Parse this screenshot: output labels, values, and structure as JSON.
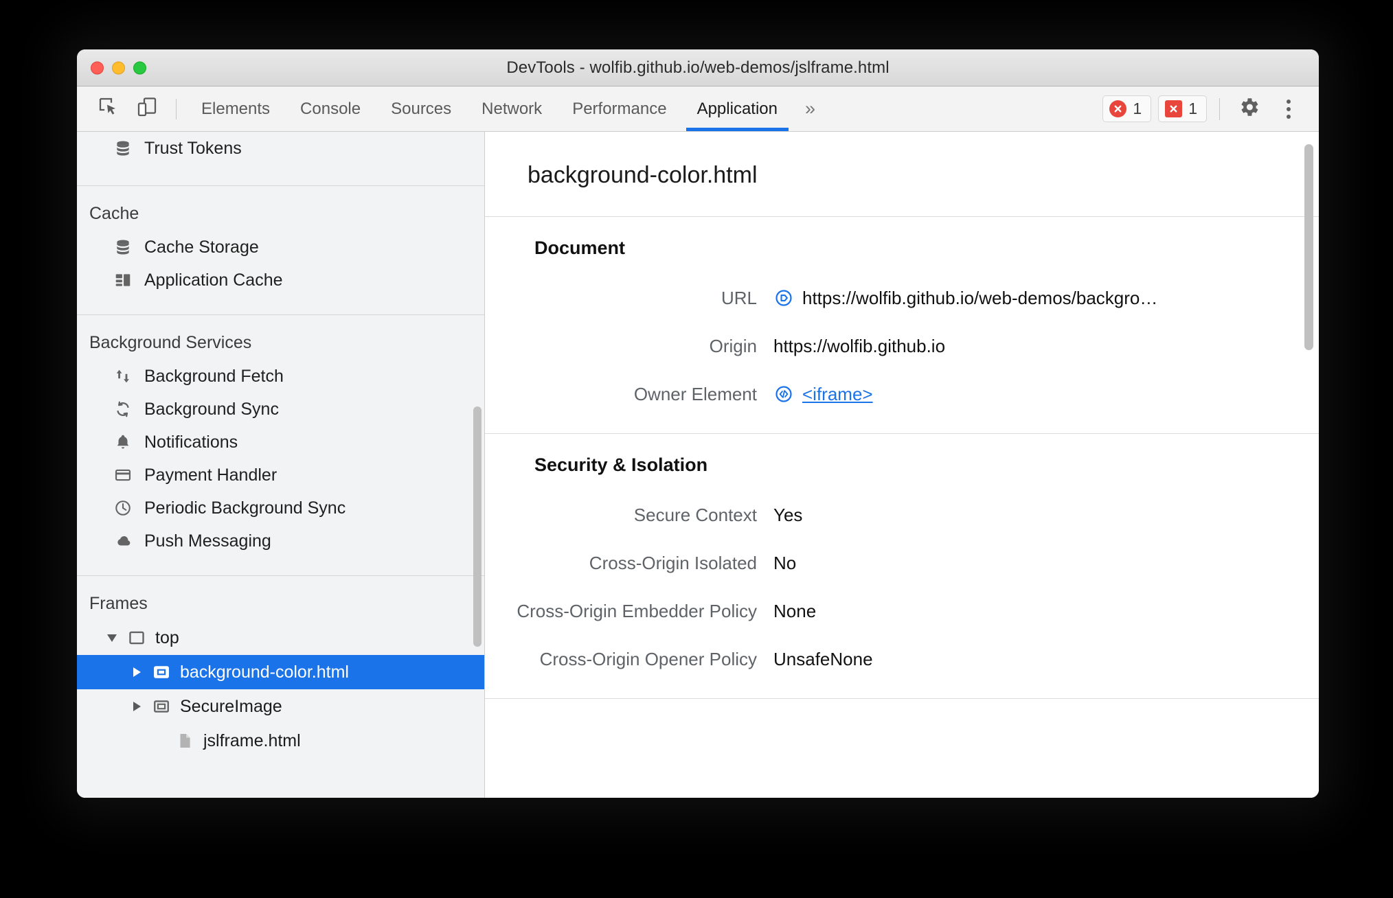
{
  "window": {
    "title": "DevTools - wolfib.github.io/web-demos/jslframe.html"
  },
  "toolbar": {
    "inspect_icon": "inspect-element-icon",
    "device_icon": "device-toolbar-icon",
    "tabs": [
      {
        "label": "Elements",
        "active": false
      },
      {
        "label": "Console",
        "active": false
      },
      {
        "label": "Sources",
        "active": false
      },
      {
        "label": "Network",
        "active": false
      },
      {
        "label": "Performance",
        "active": false
      },
      {
        "label": "Application",
        "active": true
      }
    ],
    "more_tabs": "»",
    "errors": {
      "count": "1",
      "icon": "circle-x-icon"
    },
    "issues": {
      "count": "1",
      "icon": "square-x-icon"
    },
    "settings_icon": "gear-icon",
    "menu_icon": "kebab-menu-icon",
    "accent_color": "#1a73e8",
    "error_color": "#e8453c"
  },
  "sidebar": {
    "groups": [
      {
        "header": "",
        "items": [
          {
            "label": "Trust Tokens",
            "icon": "database-icon"
          }
        ]
      },
      {
        "header": "Cache",
        "items": [
          {
            "label": "Cache Storage",
            "icon": "database-icon"
          },
          {
            "label": "Application Cache",
            "icon": "grid-icon"
          }
        ]
      },
      {
        "header": "Background Services",
        "items": [
          {
            "label": "Background Fetch",
            "icon": "arrows-up-down-icon"
          },
          {
            "label": "Background Sync",
            "icon": "refresh-sync-icon"
          },
          {
            "label": "Notifications",
            "icon": "bell-icon"
          },
          {
            "label": "Payment Handler",
            "icon": "credit-card-icon"
          },
          {
            "label": "Periodic Background Sync",
            "icon": "clock-icon"
          },
          {
            "label": "Push Messaging",
            "icon": "cloud-icon"
          }
        ]
      }
    ],
    "frames": {
      "header": "Frames",
      "tree": [
        {
          "label": "top",
          "icon": "frame-icon",
          "expanded": true,
          "level": 1,
          "selected": false
        },
        {
          "label": "background-color.html",
          "icon": "subframe-icon",
          "expanded": false,
          "level": 2,
          "selected": true
        },
        {
          "label": "SecureImage",
          "icon": "subframe-icon",
          "expanded": false,
          "level": 2,
          "selected": false
        },
        {
          "label": "jslframe.html",
          "icon": "document-icon",
          "expanded": null,
          "level": 3,
          "selected": false
        }
      ]
    }
  },
  "main": {
    "title": "background-color.html",
    "sections": [
      {
        "heading": "Document",
        "rows": [
          {
            "key": "URL",
            "value": "https://wolfib.github.io/web-demos/backgro…",
            "icon": "open-external-blue-icon",
            "link": false
          },
          {
            "key": "Origin",
            "value": "https://wolfib.github.io",
            "icon": "",
            "link": false
          },
          {
            "key": "Owner Element",
            "value": "<iframe>",
            "icon": "code-brackets-blue-icon",
            "link": true
          }
        ]
      },
      {
        "heading": "Security & Isolation",
        "rows": [
          {
            "key": "Secure Context",
            "value": "Yes",
            "icon": "",
            "link": false
          },
          {
            "key": "Cross-Origin Isolated",
            "value": "No",
            "icon": "",
            "link": false
          },
          {
            "key": "Cross-Origin Embedder Policy",
            "value": "None",
            "icon": "",
            "link": false
          },
          {
            "key": "Cross-Origin Opener Policy",
            "value": "UnsafeNone",
            "icon": "",
            "link": false
          }
        ]
      }
    ]
  }
}
